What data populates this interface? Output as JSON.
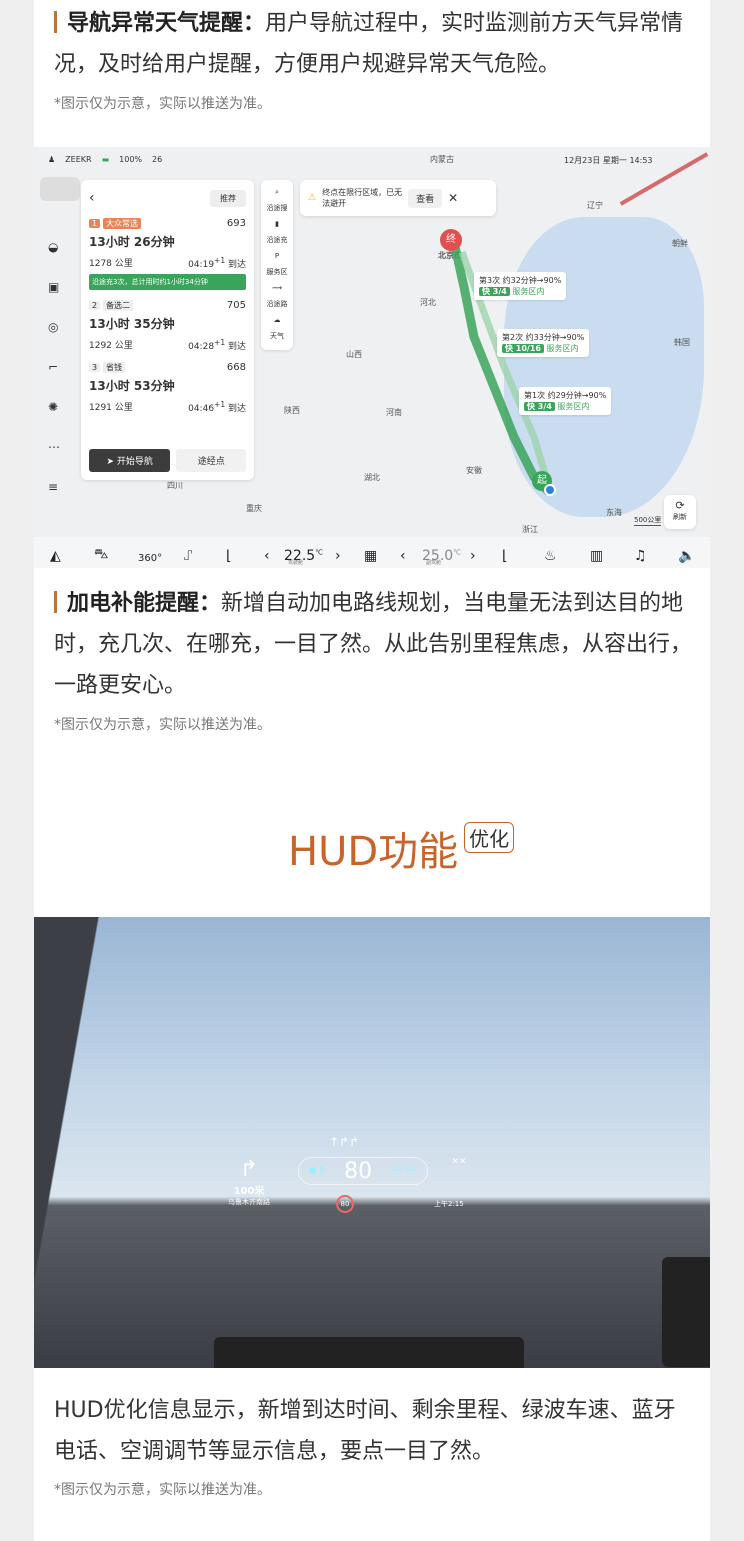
{
  "section1": {
    "title": "导航异常天气提醒：",
    "body": "用户导航过程中，实时监测前方天气异常情况，及时给用户提醒，方便用户规避异常天气危险。",
    "note": "*图示仅为示意，实际以推送为准。"
  },
  "map": {
    "status": {
      "user": "ZEEKR",
      "battery": "100%",
      "range": "26",
      "datetime": "12月23日 星期一 14:53"
    },
    "panel": {
      "recommend": "推荐",
      "routes": [
        {
          "index": "1",
          "tag": "大众常选",
          "score": "693",
          "duration": "13小时 26分钟",
          "distance": "1278 公里",
          "arrival": "04:19",
          "plus": "+1",
          "arrive_label": "到达",
          "charge": "沿途充3次，总计用时约1小时34分钟"
        },
        {
          "index": "2",
          "tag": "备选二",
          "score": "705",
          "duration": "13小时 35分钟",
          "distance": "1292 公里",
          "arrival": "04:28",
          "plus": "+1",
          "arrive_label": "到达"
        },
        {
          "index": "3",
          "tag": "省钱",
          "score": "668",
          "duration": "13小时 53分钟",
          "distance": "1291 公里",
          "arrival": "04:46",
          "plus": "+1",
          "arrive_label": "到达"
        }
      ],
      "start_nav": "开始导航",
      "waypoint": "途经点"
    },
    "tools": [
      "沿途搜",
      "沿途充",
      "服务区",
      "沿途路",
      "天气"
    ],
    "alert": {
      "text": "终点在限行区域，已无法避开",
      "view": "查看"
    },
    "provinces": [
      "内蒙古",
      "辽宁",
      "朝鲜",
      "韩国",
      "河北",
      "山西",
      "陕西",
      "河南",
      "湖北",
      "安徽",
      "四川",
      "重庆",
      "浙江",
      "东海",
      "北京市"
    ],
    "charges": [
      {
        "label": "第3次 约32分钟→90%",
        "fast": "快 3/4",
        "area": "服务区内"
      },
      {
        "label": "第2次 约33分钟→90%",
        "fast": "快 10/16",
        "area": "服务区内"
      },
      {
        "label": "第1次 约29分钟→90%",
        "fast": "快 3/4",
        "area": "服务区内"
      }
    ],
    "end_pin": "终",
    "start_pin": "起",
    "scale": "500公里",
    "refresh": "刷新",
    "temp_left": "22.5",
    "temp_right": "25.0",
    "temp_unit": "℃",
    "driver": "驾驶舱",
    "passenger": "副驾舱",
    "route_color": "#3aa55a"
  },
  "section2": {
    "title": "加电补能提醒：",
    "body": "新增自动加电路线规划，当电量无法到达目的地时，充几次、在哪充，一目了然。从此告别里程焦虑，从容出行，一路更安心。",
    "note": "*图示仅为示意，实际以推送为准。"
  },
  "hud_heading": {
    "title": "HUD功能",
    "badge": "优化",
    "color": "#c8642a"
  },
  "hud": {
    "distance": "100米",
    "road": "乌鲁木齐南路",
    "speed": "80",
    "signal": "5",
    "green_wave": "55-65",
    "limit": "80",
    "eta": "上午2:15"
  },
  "section3": {
    "body": "HUD优化信息显示，新增到达时间、剩余里程、绿波车速、蓝牙电话、空调调节等显示信息，要点一目了然。",
    "note": "*图示仅为示意，实际以推送为准。"
  }
}
